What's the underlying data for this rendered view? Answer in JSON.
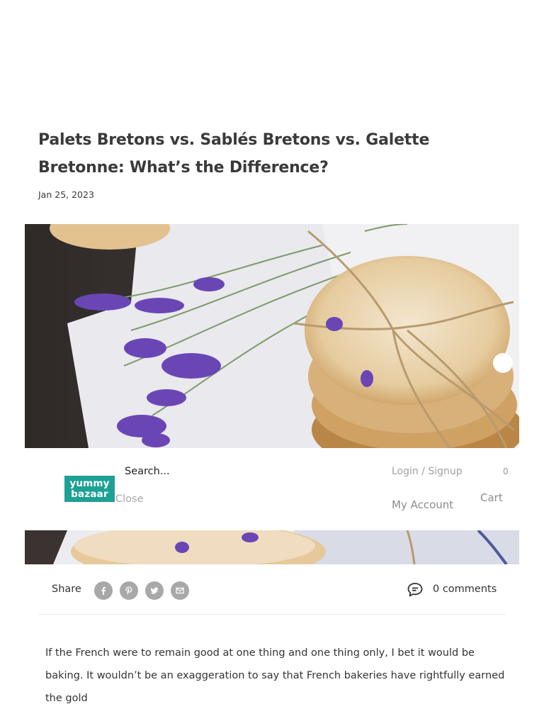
{
  "article": {
    "title": "Palets Bretons vs. Sablés Bretons vs. Galette Bretonne: What’s the Difference?",
    "date": "Jan 25, 2023",
    "hero_image": "photo of stacked Breton shortbread cookies tied with twine, lavender sprigs",
    "body_text": "If the French were to remain good at one thing and one thing only, I bet it would be baking. It wouldn’t be an exaggeration to say that French bakeries have rightfully earned the gold"
  },
  "header": {
    "logo_line1": "yummy",
    "logo_line2": "bazaar",
    "search_text": "Search...",
    "close_label": "Close",
    "login_label": "Login / Signup",
    "account_label": "My Account",
    "cart_label": "Cart",
    "cart_count": "0"
  },
  "share": {
    "label": "Share",
    "icons": [
      "facebook-icon",
      "pinterest-icon",
      "twitter-icon",
      "email-icon"
    ],
    "comments_label": "0 comments"
  },
  "colors": {
    "brand": "#1ea095",
    "social_icon_bg": "#a8a8a8",
    "muted_text": "#a0a0a0"
  }
}
